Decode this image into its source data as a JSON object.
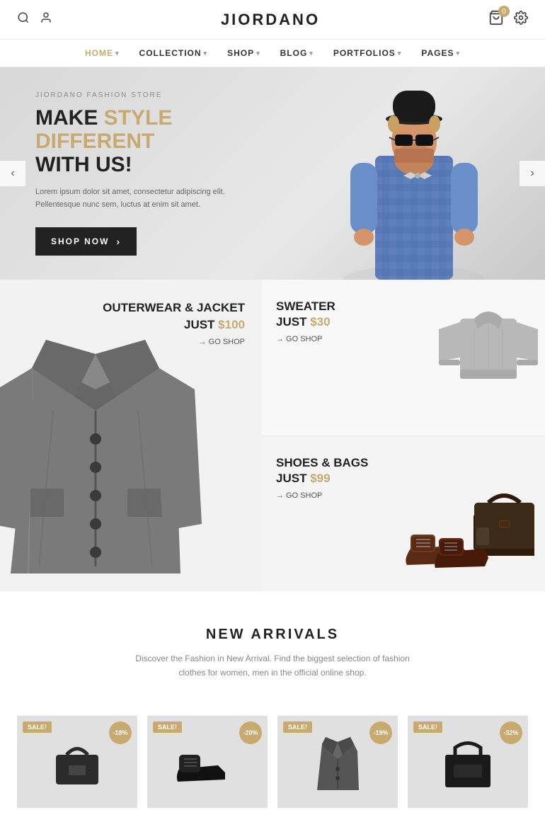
{
  "header": {
    "logo": "JIORDANO",
    "cart_count": "0",
    "icons": {
      "search": "🔍",
      "user": "👤",
      "cart": "🛒",
      "settings": "⚙"
    }
  },
  "nav": {
    "items": [
      {
        "label": "HOME",
        "active": true,
        "has_dropdown": true
      },
      {
        "label": "COLLECTION",
        "active": false,
        "has_dropdown": true
      },
      {
        "label": "SHOP",
        "active": false,
        "has_dropdown": true
      },
      {
        "label": "BLOG",
        "active": false,
        "has_dropdown": true
      },
      {
        "label": "PORTFOLIOS",
        "active": false,
        "has_dropdown": true
      },
      {
        "label": "PAGES",
        "active": false,
        "has_dropdown": true
      }
    ]
  },
  "hero": {
    "store_name": "JIORDANO FASHION STORE",
    "headline_part1": "MAKE ",
    "headline_highlight": "STYLE DIFFERENT",
    "headline_part2": "WITH US!",
    "subtitle": "Lorem ipsum dolor sit amet, consectetur adipiscing elit.\nPellentesque nunc sem, luctus at enim sit amet.",
    "cta_label": "SHOP NOW",
    "slider_left": "‹",
    "slider_right": "›"
  },
  "categories": [
    {
      "id": "outerwear",
      "title": "OUTERWEAR & JACKET",
      "subtitle": "JUST ",
      "price": "$100",
      "link": "→ GO SHOP"
    },
    {
      "id": "sweater",
      "title": "SWEATER",
      "subtitle": "JUST ",
      "price": "$30",
      "link": "→ GO SHOP"
    },
    {
      "id": "shoes",
      "title": "SHOES & BAGS",
      "subtitle": "JUST ",
      "price": "$99",
      "link": "→ GO SHOP"
    }
  ],
  "new_arrivals": {
    "title": "NEW ARRIVALS",
    "subtitle": "Discover the Fashion in New Arrival. Find the biggest selection of fashion clothes for women, men in the official online shop.",
    "products": [
      {
        "badge_sale": "SALE!",
        "badge_discount": "-18%"
      },
      {
        "badge_sale": "SALE!",
        "badge_discount": "-20%"
      },
      {
        "badge_sale": "SALE!",
        "badge_discount": "-19%"
      },
      {
        "badge_sale": "SALE!",
        "badge_discount": "-32%"
      }
    ]
  }
}
